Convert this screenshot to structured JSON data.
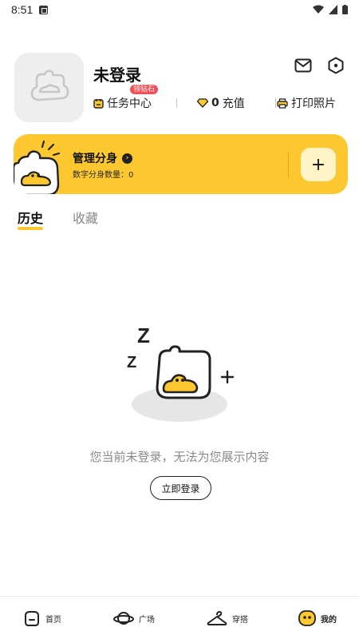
{
  "status_bar": {
    "time": "8:51"
  },
  "profile": {
    "username": "未登录",
    "badge": "领钻石"
  },
  "stats": {
    "task_center": "任务中心",
    "recharge_count": "0",
    "recharge_label": "充值",
    "print_photos": "打印照片"
  },
  "clone_card": {
    "title": "管理分身",
    "subtitle": "数字分身数量：0",
    "add_symbol": "+"
  },
  "tabs": [
    {
      "label": "历史",
      "active": true
    },
    {
      "label": "收藏",
      "active": false
    }
  ],
  "empty_state": {
    "message": "您当前未登录，无法为您展示内容",
    "login_button": "立即登录"
  },
  "bottom_nav": [
    {
      "label": "首页",
      "icon": "home-icon"
    },
    {
      "label": "广场",
      "icon": "planet-icon"
    },
    {
      "label": "穿搭",
      "icon": "hanger-icon"
    },
    {
      "label": "我的",
      "icon": "mine-face-icon"
    }
  ],
  "colors": {
    "accent": "#fcc72f",
    "badge": "#f25056",
    "muted": "#8a8a8a"
  }
}
